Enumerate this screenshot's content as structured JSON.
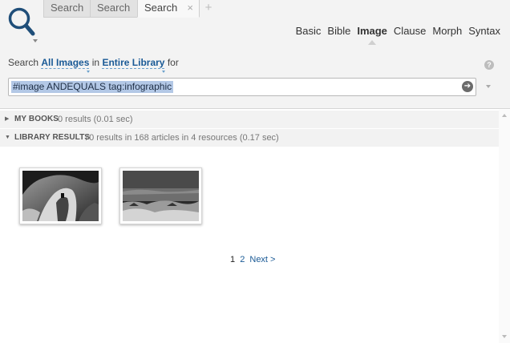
{
  "tabs": [
    {
      "label": "Search",
      "active": false
    },
    {
      "label": "Search",
      "active": false
    },
    {
      "label": "Search",
      "active": true,
      "close": "×"
    }
  ],
  "tab_add": "+",
  "modes": [
    "Basic",
    "Bible",
    "Image",
    "Clause",
    "Morph",
    "Syntax"
  ],
  "active_mode": "Image",
  "search_for": {
    "prefix": "Search",
    "scope_type": "All Images",
    "in": "in",
    "scope_library": "Entire Library",
    "suffix": "for"
  },
  "query": {
    "value": "#image ANDEQUALS tag:infographic"
  },
  "help_icon": "?",
  "go_icon": "arrow-right-icon",
  "sections": [
    {
      "label": "MY BOOKS",
      "count": "0 results (0.01 sec)",
      "expanded": false
    },
    {
      "label": "LIBRARY RESULTS",
      "count": "70 results in 168 articles in 4 resources (0.17 sec)",
      "expanded": true
    }
  ],
  "images": [
    {
      "name": "cave-ruins-photo"
    },
    {
      "name": "sea-landscape-photo"
    }
  ],
  "pagination": {
    "current": "1",
    "pages": [
      "2"
    ],
    "next": "Next >"
  },
  "colors": {
    "link": "#1a5a96",
    "selection": "#b3c8e6",
    "header_bg": "#f3f3f3",
    "logo": "#1f4e79"
  }
}
